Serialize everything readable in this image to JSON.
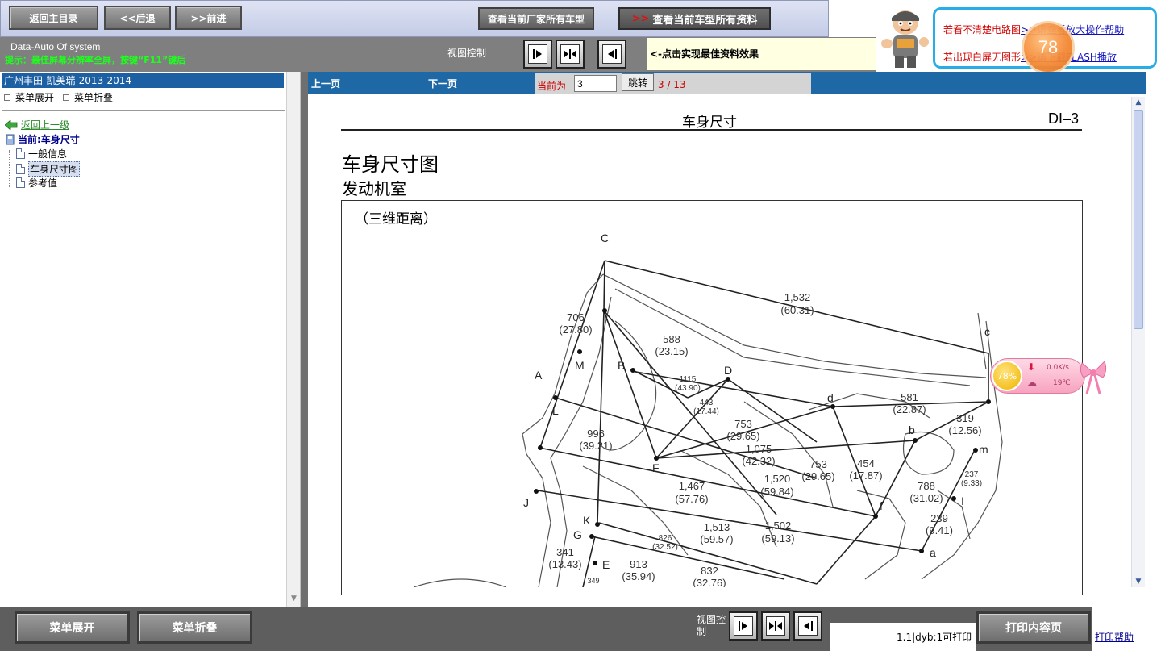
{
  "toolbar": {
    "home_label": "返回主目录",
    "back_label": "<<后退",
    "forward_label": ">>前进",
    "models_label": "查看当前厂家所有车型",
    "alldata_arrow": ">>",
    "alldata_label": "查看当前车型所有资料",
    "system_title": "Data-Auto Of system",
    "hint": "提示：最佳屏幕分辨率全屏，按键“F11”键后",
    "view_label": "视图控制",
    "view_note": "<-点击实现最佳资料效果"
  },
  "help": {
    "line1_prefix": "若看不清楚电路图",
    "line1_link": ">>请查看放大操作帮助",
    "line2_prefix": "若出现白屏无图形",
    "line2_link": ">>请下载FLASH播放",
    "badge": "78"
  },
  "sidebar": {
    "title": "广州丰田-凯美瑞-2013-2014",
    "expand_label": "菜单展开",
    "collapse_label": "菜单折叠",
    "back_up": "返回上一级",
    "current": "当前:车身尺寸",
    "items": [
      {
        "label": "一般信息",
        "selected": false
      },
      {
        "label": "车身尺寸图",
        "selected": true
      },
      {
        "label": "参考值",
        "selected": false
      }
    ]
  },
  "docnav": {
    "prev": "上一页",
    "next": "下一页",
    "current_label": "当前为",
    "page_value": "3",
    "jump": "跳转",
    "page_count": "3 / 13"
  },
  "document": {
    "section": "车身尺寸",
    "page_code": "DI–3",
    "title": "车身尺寸图",
    "subtitle": "发动机室",
    "caption": "（三维距离）",
    "point_labels": [
      "C",
      "c",
      "A",
      "M",
      "B",
      "D",
      "d",
      "L",
      "b",
      "m",
      "F",
      "J",
      "K",
      "G",
      "E",
      "I",
      "f",
      "a"
    ],
    "measurements": [
      {
        "v": "1,532",
        "in": "(60.31)"
      },
      {
        "v": "706",
        "in": "(27.80)"
      },
      {
        "v": "588",
        "in": "(23.15)"
      },
      {
        "v": "1115",
        "in": "(43.90)"
      },
      {
        "v": "443",
        "in": "(17.44)"
      },
      {
        "v": "581",
        "in": "(22.87)"
      },
      {
        "v": "319",
        "in": "(12.56)"
      },
      {
        "v": "753",
        "in": "(29.65)"
      },
      {
        "v": "996",
        "in": "(39.21)"
      },
      {
        "v": "1,075",
        "in": "(42.32)"
      },
      {
        "v": "753",
        "in": "(29.65)"
      },
      {
        "v": "454",
        "in": "(17.87)"
      },
      {
        "v": "1,520",
        "in": "(59.84)"
      },
      {
        "v": "1,467",
        "in": "(57.76)"
      },
      {
        "v": "788",
        "in": "(31.02)"
      },
      {
        "v": "237",
        "in": "(9.33)"
      },
      {
        "v": "1,513",
        "in": "(59.57)"
      },
      {
        "v": "1,502",
        "in": "(59.13)"
      },
      {
        "v": "239",
        "in": "(9.41)"
      },
      {
        "v": "826",
        "in": "(32.52)"
      },
      {
        "v": "341",
        "in": "(13.43)"
      },
      {
        "v": "913",
        "in": "(35.94)"
      },
      {
        "v": "832",
        "in": "(32.76)"
      },
      {
        "v": "349",
        "in": ""
      }
    ]
  },
  "weather": {
    "percent": "78%",
    "speed": "0.0K/s",
    "temp": "19℃"
  },
  "bottom": {
    "expand_label": "菜单展开",
    "collapse_label": "菜单折叠",
    "view_label": "视图控制",
    "print_info": "1.1|dyb:1可打印",
    "print_label": "打印内容页",
    "print_help": "打印帮助"
  },
  "colors": {
    "nav_blue": "#1e69a5",
    "toolbar_gray": "#7f7f7f",
    "bottom_gray": "#5e5e5e",
    "accent_red": "#d00000",
    "hint_green": "#1dff1d"
  }
}
